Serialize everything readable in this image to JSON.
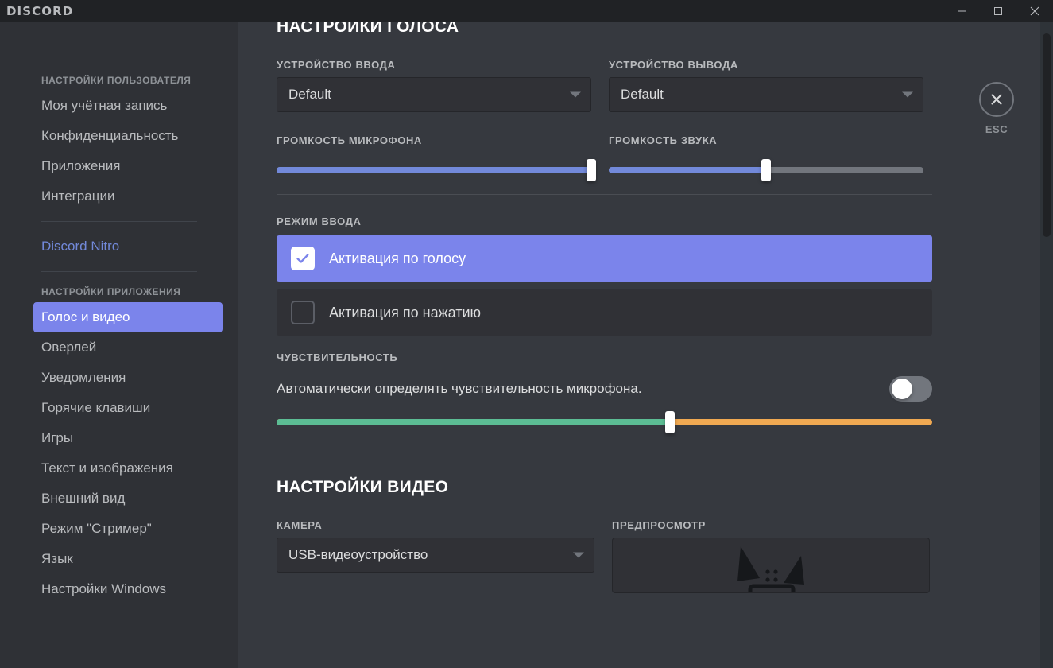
{
  "window": {
    "brand": "DISCORD",
    "controls": {
      "minimize": "minimize",
      "maximize": "maximize",
      "close": "close"
    }
  },
  "sidebar": {
    "user_group_title": "НАСТРОЙКИ ПОЛЬЗОВАТЕЛЯ",
    "user_items": [
      {
        "label": "Моя учётная запись"
      },
      {
        "label": "Конфиденциальность"
      },
      {
        "label": "Приложения"
      },
      {
        "label": "Интеграции"
      }
    ],
    "nitro": {
      "label": "Discord Nitro",
      "color": "#7289da"
    },
    "app_group_title": "НАСТРОЙКИ ПРИЛОЖЕНИЯ",
    "app_items": [
      {
        "label": "Голос и видео",
        "active": true
      },
      {
        "label": "Оверлей",
        "active": false
      },
      {
        "label": "Уведомления",
        "active": false
      },
      {
        "label": "Горячие клавиши",
        "active": false
      },
      {
        "label": "Игры",
        "active": false
      },
      {
        "label": "Текст и изображения",
        "active": false
      },
      {
        "label": "Внешний вид",
        "active": false
      },
      {
        "label": "Режим \"Стример\"",
        "active": false
      },
      {
        "label": "Язык",
        "active": false
      },
      {
        "label": "Настройки Windows",
        "active": false
      }
    ],
    "active_color": "#7b84eb"
  },
  "close_panel": {
    "icon": "close-icon",
    "label": "ESC"
  },
  "voice_settings": {
    "title": "НАСТРОЙКИ ГОЛОСА",
    "input_device": {
      "label": "УСТРОЙСТВО ВВОДА",
      "value": "Default"
    },
    "output_device": {
      "label": "УСТРОЙСТВО ВЫВОДА",
      "value": "Default"
    },
    "mic_volume": {
      "label": "ГРОМКОСТЬ МИКРОФОНА",
      "percent": 100,
      "fill_color": "#7289da"
    },
    "sound_volume": {
      "label": "ГРОМКОСТЬ ЗВУКА",
      "percent": 50,
      "fill_color": "#7289da"
    },
    "input_mode": {
      "label": "РЕЖИМ ВВОДА",
      "options": [
        {
          "label": "Активация по голосу",
          "selected": true
        },
        {
          "label": "Активация по нажатию",
          "selected": false
        }
      ]
    },
    "sensitivity": {
      "label": "ЧУВСТВИТЕЛЬНОСТЬ",
      "auto_text": "Автоматически определять чувствительность микрофона.",
      "auto_enabled": false,
      "percent": 60,
      "low_color": "#5cbd94",
      "high_color": "#f0a952"
    }
  },
  "video_settings": {
    "title": "НАСТРОЙКИ ВИДЕО",
    "camera": {
      "label": "КАМЕРА",
      "value": "USB-видеоустройство"
    },
    "preview": {
      "label": "ПРЕДПРОСМОТР"
    }
  }
}
